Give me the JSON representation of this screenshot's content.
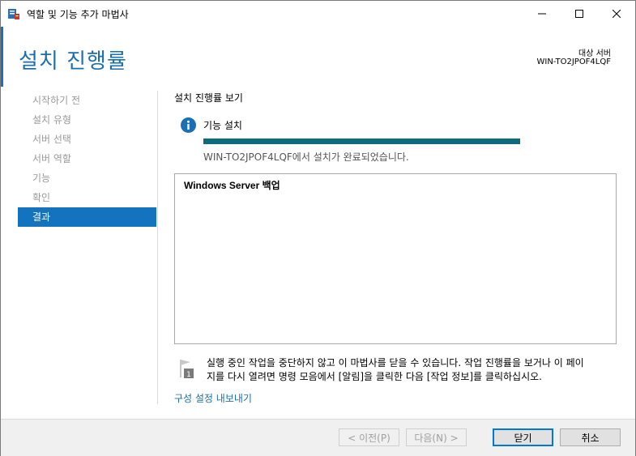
{
  "window": {
    "title": "역할 및 기능 추가 마법사"
  },
  "header": {
    "title": "설치 진행률",
    "target_label": "대상 서버",
    "target_server": "WIN-TO2JPOF4LQF"
  },
  "nav": {
    "items": [
      {
        "label": "시작하기 전",
        "active": false
      },
      {
        "label": "설치 유형",
        "active": false
      },
      {
        "label": "서버 선택",
        "active": false
      },
      {
        "label": "서버 역할",
        "active": false
      },
      {
        "label": "기능",
        "active": false
      },
      {
        "label": "확인",
        "active": false
      },
      {
        "label": "결과",
        "active": true
      }
    ]
  },
  "content": {
    "section_title": "설치 진행률 보기",
    "feature_label": "기능 설치",
    "progress_percent": 100,
    "status": "WIN-TO2JPOF4LQF에서 설치가 완료되었습니다.",
    "results": [
      "Windows Server 백업"
    ],
    "note_line1": "실행 중인 작업을 중단하지 않고 이 마법사를 닫을 수 있습니다. 작업 진행률을 보거나 이 페이",
    "note_line2": "지를 다시 열려면 명령 모음에서 [알림]을 클릭한 다음 [작업 정보]를 클릭하십시오.",
    "flag_badge": "1",
    "export_link": "구성 설정 내보내기"
  },
  "buttons": {
    "prev": "< 이전(P)",
    "next": "다음(N) >",
    "close": "닫기",
    "cancel": "취소"
  },
  "colors": {
    "accent": "#1a6fab",
    "nav_active": "#1373bf",
    "progress": "#0e6b7e"
  }
}
